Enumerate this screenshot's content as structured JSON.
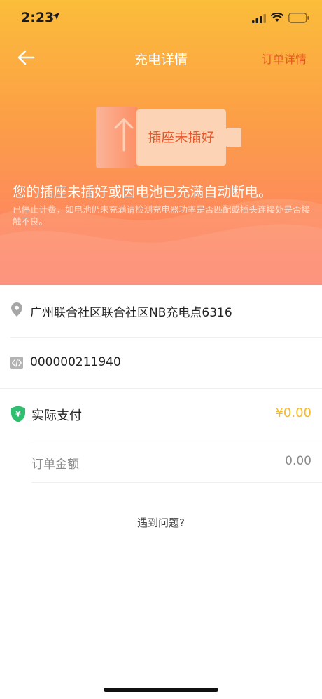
{
  "status_bar": {
    "time": "2:23"
  },
  "nav": {
    "title": "充电详情",
    "right_link": "订单详情"
  },
  "hero": {
    "badge_text": "插座未插好",
    "headline": "您的插座未插好或因电池已充满自动断电。",
    "subline": "已停止计费，如电池仍未充满请检测充电器功率是否匹配或插头连接处是否接触不良。"
  },
  "details": {
    "location": "广州联合社区联合社区NB充电点6316",
    "device_code": "000000211940",
    "actual_payment_label": "实际支付",
    "actual_payment_value": "¥0.00",
    "order_amount_label": "订单金额",
    "order_amount_value": "0.00"
  },
  "footer": {
    "problem_link": "遇到问题?"
  },
  "colors": {
    "accent_orange": "#e4571c",
    "pay_yellow": "#f8b828",
    "shield_green": "#2fbf71"
  }
}
